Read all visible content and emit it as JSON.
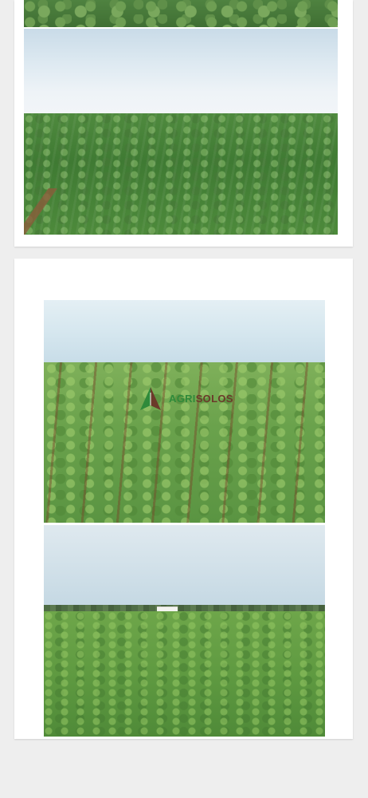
{
  "gallery": {
    "cards": [
      {
        "photos": [
          "field-top-crop",
          "soybean-field-wide"
        ]
      },
      {
        "photos": [
          "soybean-field-rows",
          "soybean-field-farmhouse"
        ]
      }
    ],
    "watermark": {
      "brand_part1": "AGRI",
      "brand_part2": "SOLOS",
      "tagline": "",
      "colors": {
        "green": "#2f8a3a",
        "brown": "#6b3a2a"
      }
    }
  }
}
